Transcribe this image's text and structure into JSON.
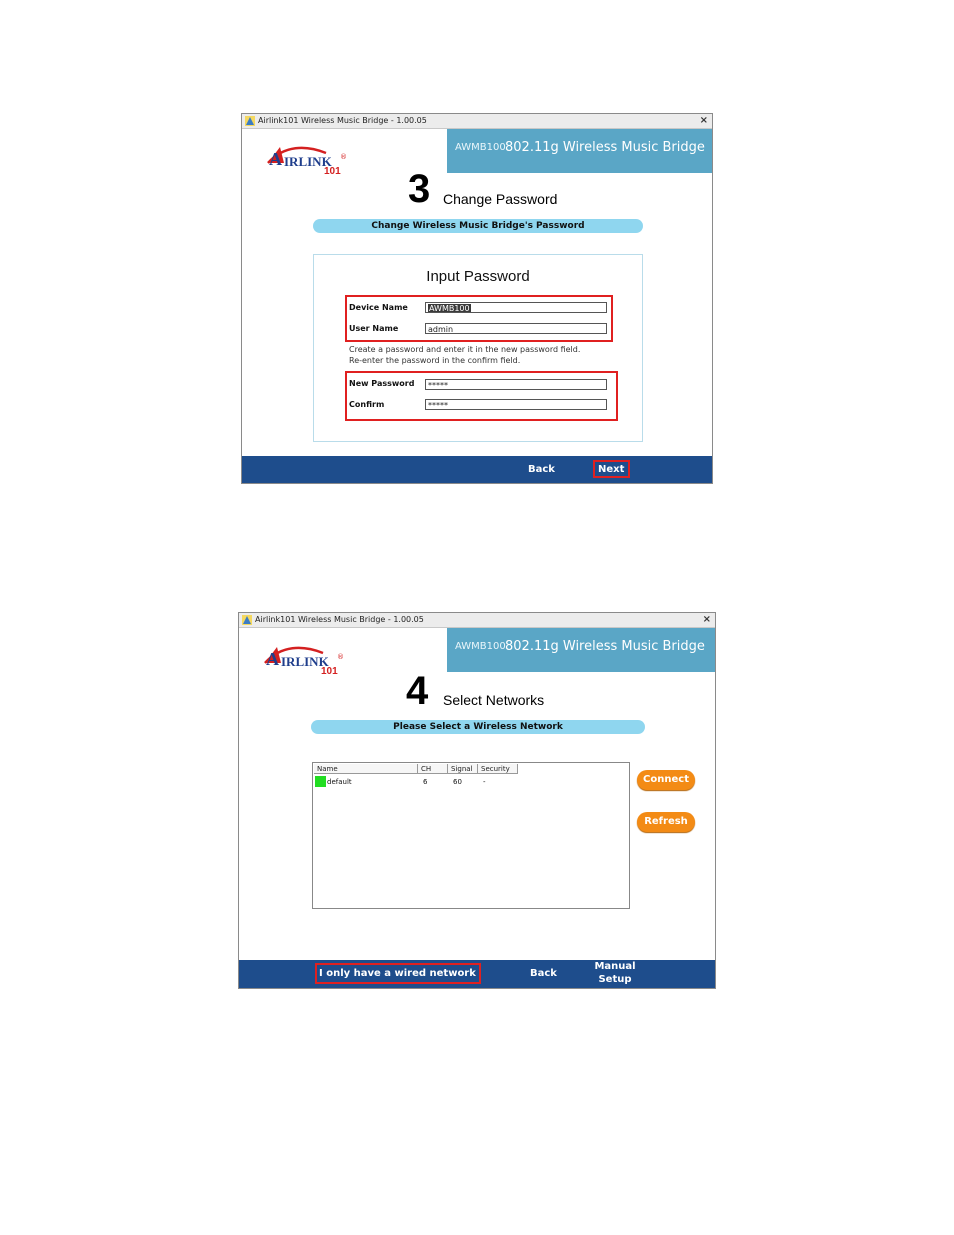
{
  "screen1": {
    "window_title": "Airlink101 Wireless Music Bridge - 1.00.05",
    "close_glyph": "×",
    "logo": {
      "a": "A",
      "irlink": "IRLINK",
      "num": "101",
      "reg": "®"
    },
    "model": "AWMB100",
    "product": "802.11g Wireless Music Bridge",
    "step_number": "3",
    "step_title": "Change Password",
    "banner": "Change Wireless Music Bridge's Password",
    "panel_title": "Input Password",
    "fields": {
      "device_name_label": "Device Name",
      "device_name_value": "AWMB100",
      "user_name_label": "User Name",
      "user_name_value": "admin",
      "new_password_label": "New Password",
      "new_password_value": "*****",
      "confirm_label": "Confirm",
      "confirm_value": "*****"
    },
    "hint_line1": "Create a password and enter it in the new password field.",
    "hint_line2": "Re-enter the password in the confirm field.",
    "footer": {
      "back": "Back",
      "next": "Next"
    }
  },
  "screen2": {
    "window_title": "Airlink101 Wireless Music Bridge - 1.00.05",
    "close_glyph": "×",
    "logo": {
      "a": "A",
      "irlink": "IRLINK",
      "num": "101",
      "reg": "®"
    },
    "model": "AWMB100",
    "product": "802.11g Wireless Music Bridge",
    "step_number": "4",
    "step_title": "Select Networks",
    "banner": "Please Select a Wireless Network",
    "table": {
      "headers": [
        "Name",
        "CH",
        "Signal",
        "Security"
      ],
      "rows": [
        {
          "name": "default",
          "ch": "6",
          "signal": "60",
          "security": "-",
          "status_color": "#22dd22"
        }
      ]
    },
    "buttons": {
      "connect": "Connect",
      "refresh": "Refresh"
    },
    "footer": {
      "wired": "I only have a wired network",
      "back": "Back",
      "manual_line1": "Manual",
      "manual_line2": "Setup"
    }
  },
  "colors": {
    "header_band": "#5aa6c6",
    "footer_bar": "#1e4d8c",
    "banner_pill": "#8fd6ef",
    "highlight_red": "#e02020",
    "orange_button": "#f38b15",
    "logo_red": "#d42020"
  }
}
